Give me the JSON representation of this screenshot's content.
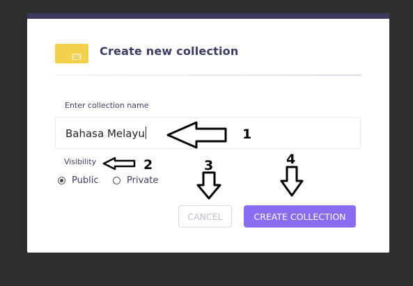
{
  "dialog": {
    "title": "Create new collection",
    "name_label": "Enter collection name",
    "name_value": "Bahasa Melayu",
    "visibility_label": "Visibility",
    "visibility_options": [
      {
        "label": "Public",
        "selected": true
      },
      {
        "label": "Private",
        "selected": false
      }
    ],
    "cancel_label": "CANCEL",
    "create_label": "CREATE COLLECTION"
  },
  "annotations": {
    "labels": [
      "1",
      "2",
      "3",
      "4"
    ]
  },
  "colors": {
    "accent": "#8b6cf0",
    "title": "#3b3c62",
    "folder": "#f1d14a",
    "topbar": "#3a3b5c",
    "backdrop": "#2e2e2e"
  }
}
